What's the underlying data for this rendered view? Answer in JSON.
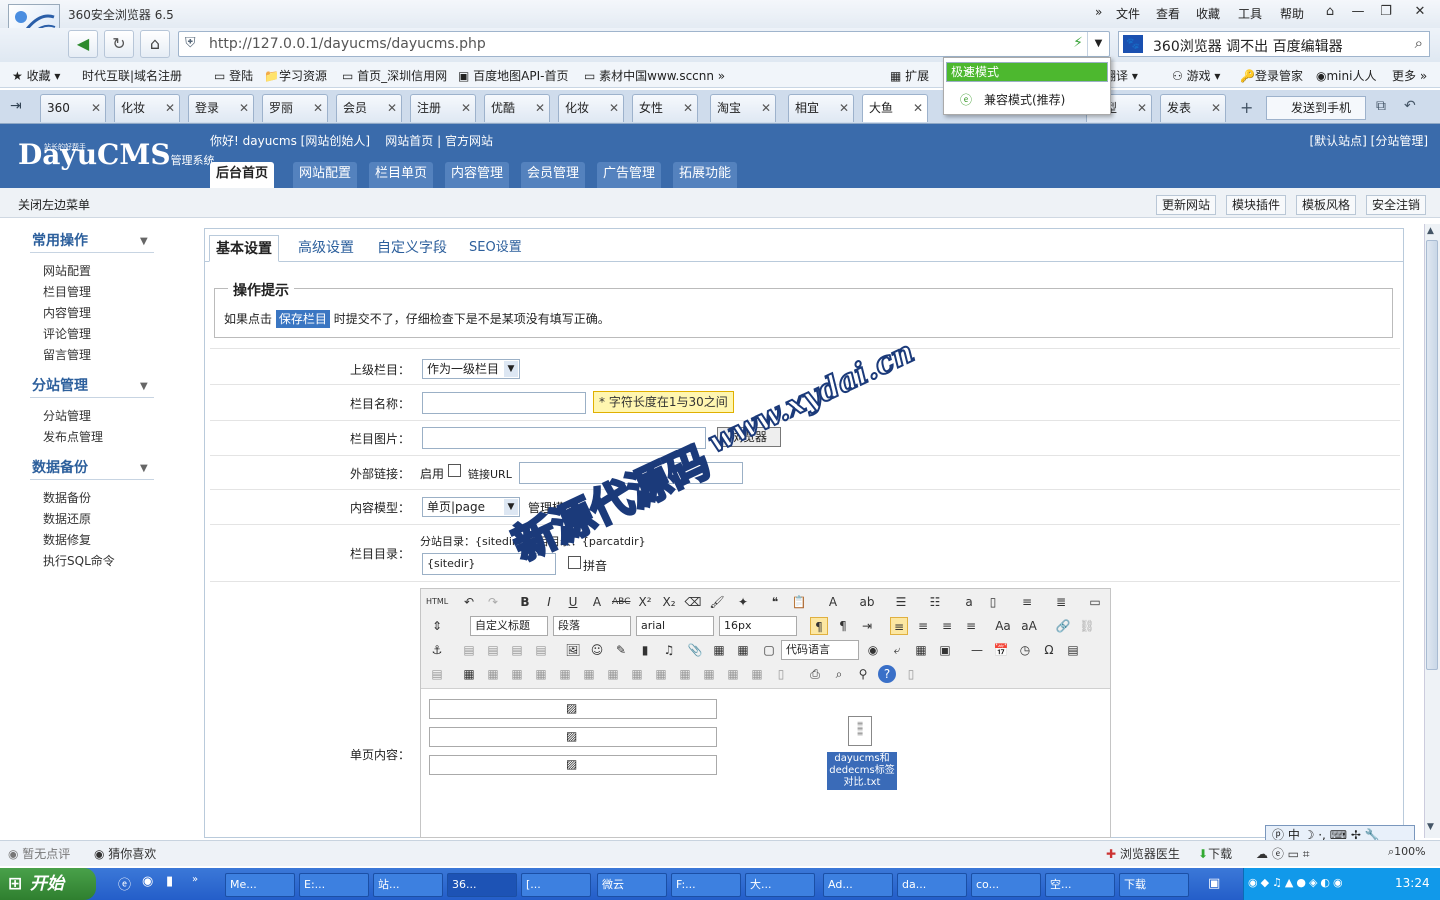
{
  "browser": {
    "title": "360安全浏览器 6.5",
    "menu": [
      "文件",
      "查看",
      "收藏",
      "工具",
      "帮助"
    ],
    "url": "http://127.0.0.1/dayucms/dayucms.php",
    "search": "360浏览器 调不出 百度编辑器",
    "bookmarks": [
      "收藏",
      "时代互联|域名注册",
      "登陆",
      "学习资源",
      "首页_深圳信用网",
      "百度地图API-首页",
      "素材中国www.sccnn",
      "扩展",
      "翻译",
      "游戏",
      "登录管家",
      "mini人人",
      "更多"
    ],
    "tabs": [
      "360",
      "化妆",
      "登录",
      "罗丽",
      "会员",
      "注册",
      "优酷",
      "化妆",
      "女性",
      "淘宝",
      "相宜",
      "大鱼",
      "模型",
      "发表"
    ],
    "send_to_phone": "发送到手机",
    "mode_menu": {
      "fast": "极速模式",
      "compat": "兼容模式(推荐)"
    }
  },
  "cms": {
    "logo": "DayuCMS",
    "logo_sub": "管理系统",
    "logo_tag": "站长的好帮手",
    "greeting": "你好! dayucms [网站创始人]",
    "links": "网站首页 | 官方网站",
    "site_right": "[默认站点] [分站管理]",
    "nav": [
      "后台首页",
      "网站配置",
      "栏目单页",
      "内容管理",
      "会员管理",
      "广告管理",
      "拓展功能"
    ],
    "close_menu": "关闭左边菜单",
    "tools": [
      "更新网站",
      "模块插件",
      "模板风格",
      "安全注销"
    ]
  },
  "sidebar": {
    "sections": [
      {
        "title": "常用操作",
        "items": [
          "网站配置",
          "栏目管理",
          "内容管理",
          "评论管理",
          "留言管理"
        ]
      },
      {
        "title": "分站管理",
        "items": [
          "分站管理",
          "发布点管理"
        ]
      },
      {
        "title": "数据备份",
        "items": [
          "数据备份",
          "数据还原",
          "数据修复",
          "执行SQL命令"
        ]
      }
    ]
  },
  "content": {
    "tabs": [
      "基本设置",
      "高级设置",
      "自定义字段",
      "SEO设置"
    ],
    "tip_title": "操作提示",
    "tip_pre": "如果点击",
    "tip_hl": "保存栏目",
    "tip_post": "时提交不了，仔细检查下是不是某项没有填写正确。",
    "fields": {
      "parent_label": "上级栏目：",
      "parent_value": "作为一级栏目",
      "name_label": "栏目名称：",
      "name_hint": "* 字符长度在1与30之间",
      "image_label": "栏目图片：",
      "image_btn": "浏览器",
      "link_label": "外部链接：",
      "link_enable": "启用",
      "link_url": "链接URL",
      "model_label": "内容模型：",
      "model_value": "单页|page",
      "model_extra": "管理模型",
      "dir_label": "栏目目录：",
      "dir_text": "分站目录：{sitedir} 栏目目录：{parcatdir}",
      "dir_value": "{sitedir}",
      "pinyin": "拼音",
      "page_label": "单页内容："
    },
    "editor": {
      "heading": "自定义标题",
      "para": "段落",
      "font": "arial",
      "size": "16px",
      "codelang": "代码语言"
    },
    "file_label": "dayucms和dedecms标签对比.txt"
  },
  "watermark": {
    "line1": "www.xydai.cn",
    "line2": "新源代源码"
  },
  "status": {
    "left1": "暂无点评",
    "left2": "猜你喜欢",
    "doctor": "浏览器医生",
    "download": "下载",
    "zoom": "100%"
  },
  "ime": "中",
  "taskbar": {
    "start": "开始",
    "items": [
      "Me...",
      "E:...",
      "站...",
      "36...",
      "[...",
      "微云",
      "F:...",
      "大...",
      "Ad...",
      "da...",
      "co...",
      "空...",
      "下载"
    ],
    "time": "13:24"
  }
}
